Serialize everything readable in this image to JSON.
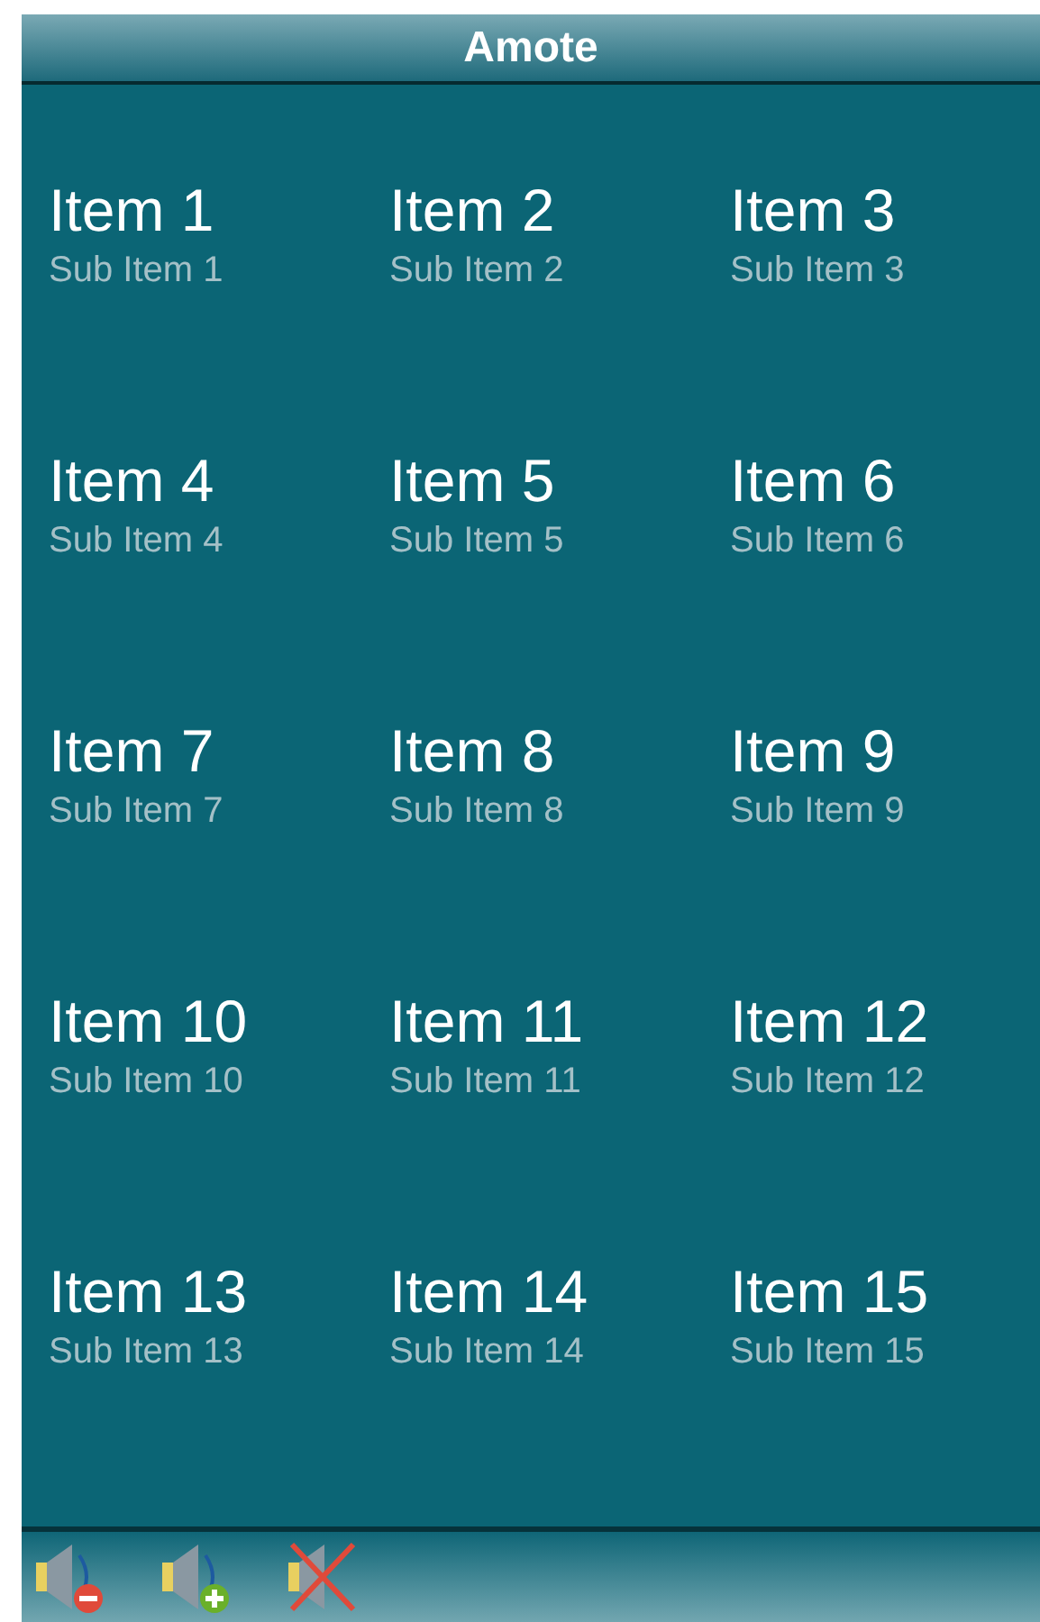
{
  "title_bar": {
    "title": "Amote"
  },
  "items": [
    {
      "title": "Item 1",
      "subtitle": "Sub Item 1"
    },
    {
      "title": "Item 2",
      "subtitle": "Sub Item 2"
    },
    {
      "title": "Item 3",
      "subtitle": "Sub Item 3"
    },
    {
      "title": "Item 4",
      "subtitle": "Sub Item 4"
    },
    {
      "title": "Item 5",
      "subtitle": "Sub Item 5"
    },
    {
      "title": "Item 6",
      "subtitle": "Sub Item 6"
    },
    {
      "title": "Item 7",
      "subtitle": "Sub Item 7"
    },
    {
      "title": "Item 8",
      "subtitle": "Sub Item 8"
    },
    {
      "title": "Item 9",
      "subtitle": "Sub Item 9"
    },
    {
      "title": "Item 10",
      "subtitle": "Sub Item 10"
    },
    {
      "title": "Item 11",
      "subtitle": "Sub Item 11"
    },
    {
      "title": "Item 12",
      "subtitle": "Sub Item 12"
    },
    {
      "title": "Item 13",
      "subtitle": "Sub Item 13"
    },
    {
      "title": "Item 14",
      "subtitle": "Sub Item 14"
    },
    {
      "title": "Item 15",
      "subtitle": "Sub Item 15"
    }
  ]
}
